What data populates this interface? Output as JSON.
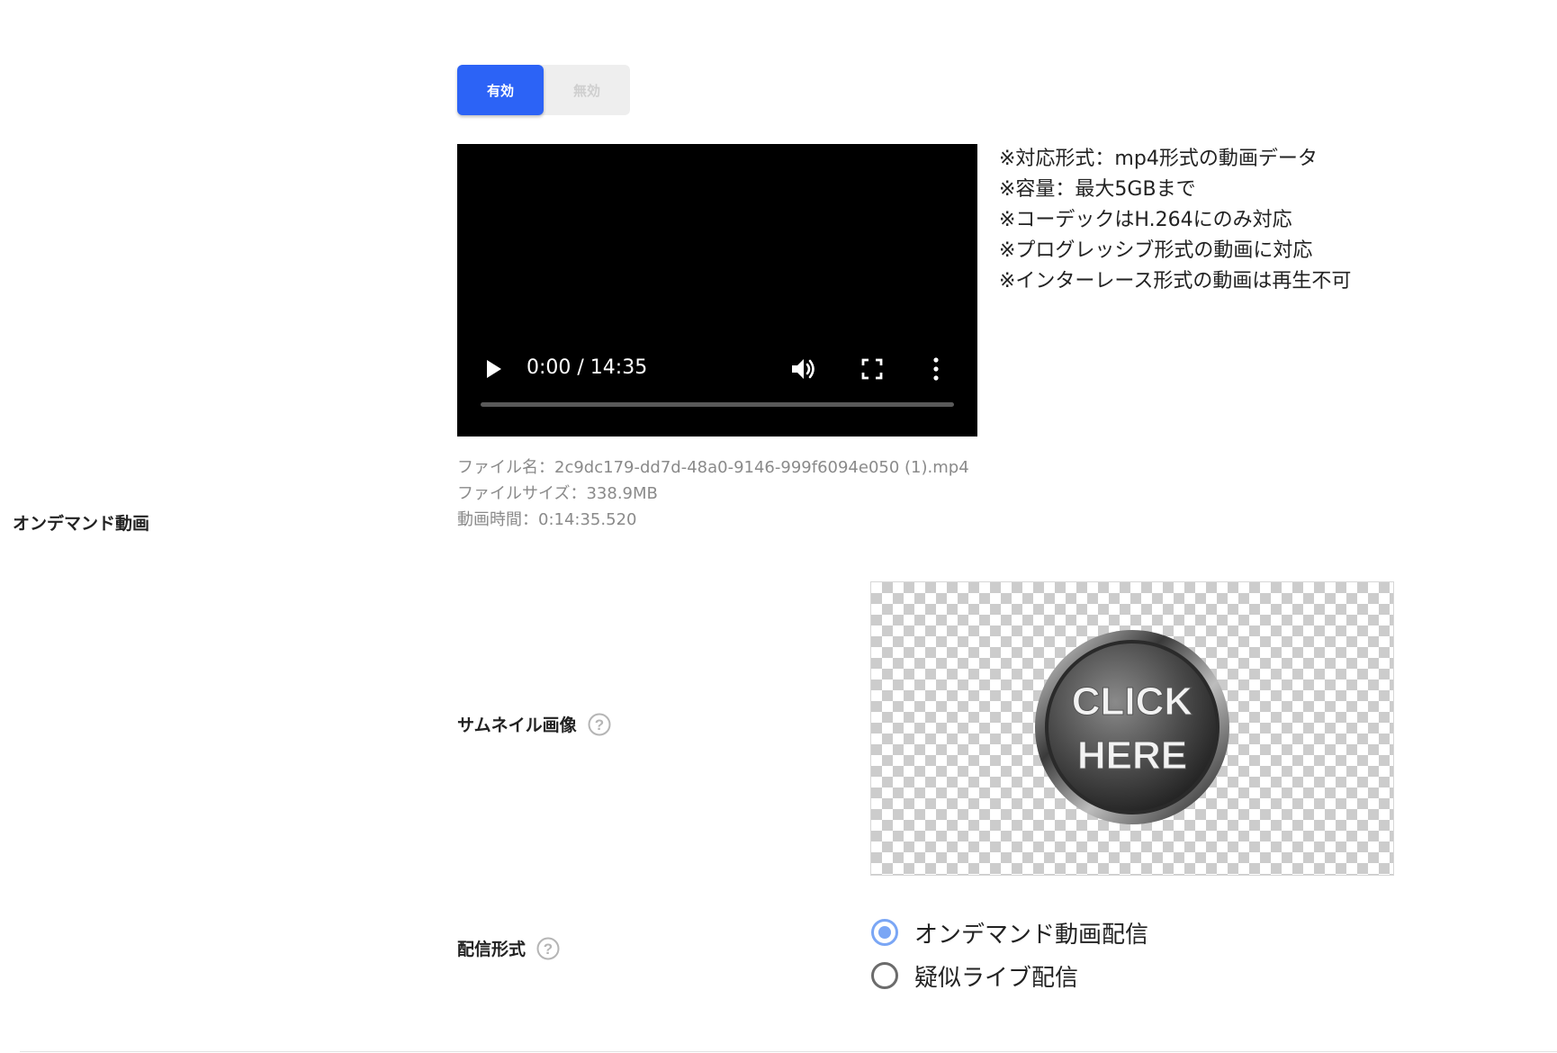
{
  "section": {
    "title": "オンデマンド動画"
  },
  "toggle": {
    "enabled_label": "有効",
    "disabled_label": "無効",
    "selected": "enabled"
  },
  "video": {
    "time_display": "0:00 / 14:35",
    "progress": 0
  },
  "notes": [
    "※対応形式：mp4形式の動画データ",
    "※容量：最大5GBまで",
    "※コーデックはH.264にのみ対応",
    "※プログレッシブ形式の動画に対応",
    "※インターレース形式の動画は再生不可"
  ],
  "file_info": {
    "file_name": "ファイル名：2c9dc179-dd7d-48a0-9146-999f6094e050 (1).mp4",
    "file_size": "ファイルサイズ：338.9MB",
    "duration": "動画時間：0:14:35.520"
  },
  "thumbnail": {
    "label": "サムネイル画像",
    "image_text_line1": "CLICK",
    "image_text_line2": "HERE"
  },
  "delivery": {
    "label": "配信形式",
    "options": [
      {
        "label": "オンデマンド動画配信",
        "checked": true
      },
      {
        "label": "疑似ライブ配信",
        "checked": false
      }
    ]
  },
  "colors": {
    "accent": "#2c63f6",
    "radio_checked": "#7aa6f5"
  }
}
